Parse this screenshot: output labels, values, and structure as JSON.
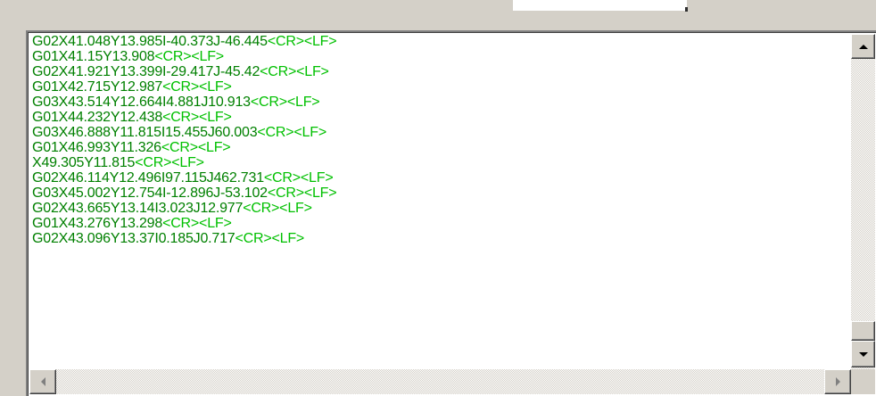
{
  "textbox": {
    "terminator": "<CR><LF>",
    "lines": [
      "G02X41.048Y13.985I-40.373J-46.445",
      "G01X41.15Y13.908",
      "G02X41.921Y13.399I-29.417J-45.42",
      "G01X42.715Y12.987",
      "G03X43.514Y12.664I4.881J10.913",
      "G01X44.232Y12.438",
      "G03X46.888Y11.815I15.455J60.003",
      "G01X46.993Y11.326",
      "X49.305Y11.815",
      "G02X46.114Y12.496I97.115J462.731",
      "G03X45.002Y12.754I-12.896J-53.102",
      "G02X43.665Y13.14I3.023J12.977",
      "G01X43.276Y13.298",
      "G02X43.096Y13.37I0.185J0.717"
    ]
  },
  "scrollbars": {
    "up_icon": "arrow-up-icon",
    "down_icon": "arrow-down-icon",
    "left_icon": "arrow-left-icon",
    "right_icon": "arrow-right-icon"
  },
  "colors": {
    "code_text": "#008000",
    "terminator_text": "#00c000"
  }
}
